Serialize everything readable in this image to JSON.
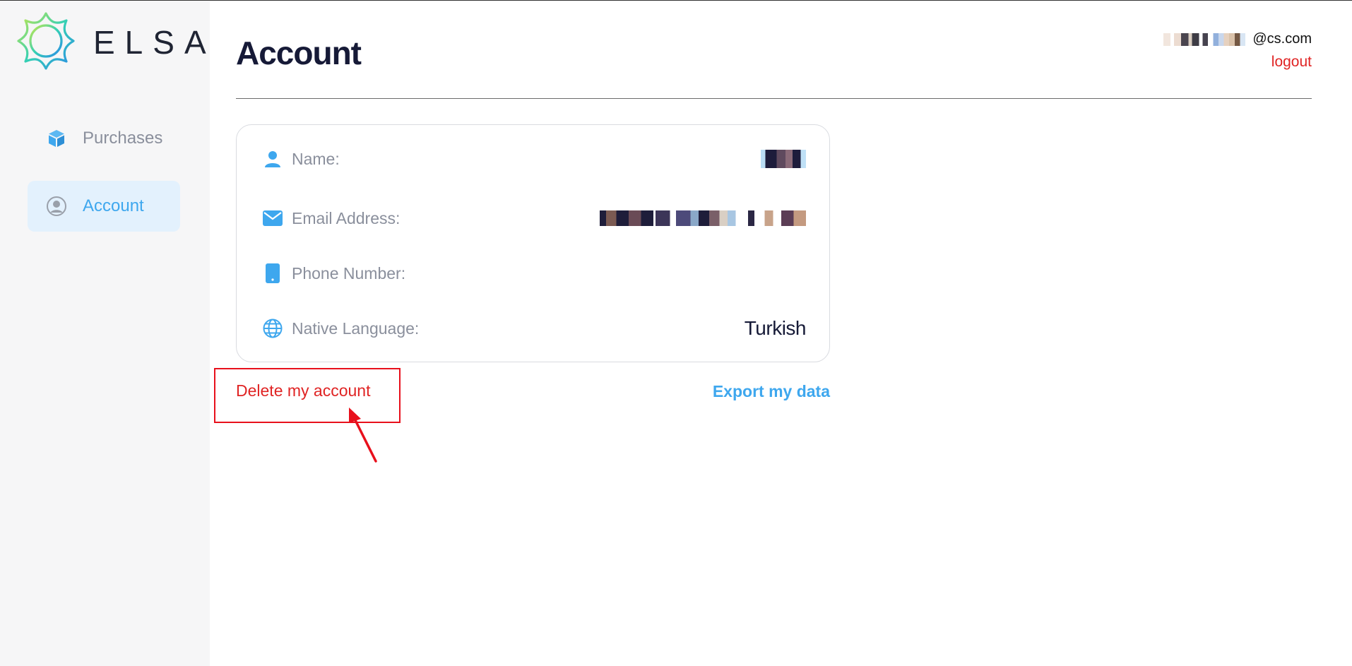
{
  "app": {
    "logo_text": "ELSA"
  },
  "sidebar": {
    "items": [
      {
        "label": "Purchases",
        "icon": "cube-icon"
      },
      {
        "label": "Account",
        "icon": "user-circle-icon",
        "active": true
      }
    ]
  },
  "header": {
    "title": "Account",
    "user_email_suffix": "@cs.com",
    "logout_label": "logout"
  },
  "account": {
    "fields": [
      {
        "label": "Name:",
        "value": "",
        "icon": "person-icon"
      },
      {
        "label": "Email Address:",
        "value": "",
        "icon": "mail-icon"
      },
      {
        "label": "Phone Number:",
        "value": "",
        "icon": "phone-icon"
      },
      {
        "label": "Native Language:",
        "value": "Turkish",
        "icon": "globe-icon"
      }
    ]
  },
  "actions": {
    "delete_label": "Delete my account",
    "export_label": "Export my data"
  },
  "colors": {
    "accent": "#3ea7ee",
    "danger": "#e02424",
    "title": "#161a37",
    "annotation": "#e8101c"
  }
}
